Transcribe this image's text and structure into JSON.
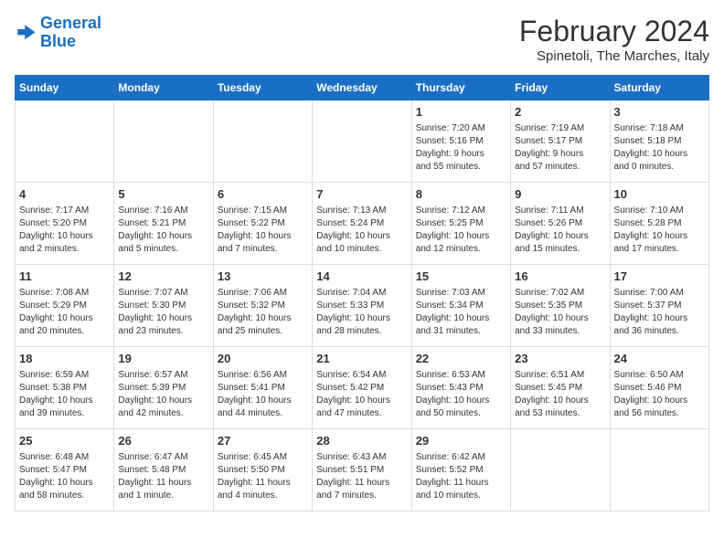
{
  "logo": {
    "line1": "General",
    "line2": "Blue"
  },
  "title": "February 2024",
  "subtitle": "Spinetoli, The Marches, Italy",
  "header": {
    "days": [
      "Sunday",
      "Monday",
      "Tuesday",
      "Wednesday",
      "Thursday",
      "Friday",
      "Saturday"
    ]
  },
  "weeks": [
    [
      {
        "day": "",
        "content": ""
      },
      {
        "day": "",
        "content": ""
      },
      {
        "day": "",
        "content": ""
      },
      {
        "day": "",
        "content": ""
      },
      {
        "day": "1",
        "content": "Sunrise: 7:20 AM\nSunset: 5:16 PM\nDaylight: 9 hours\nand 55 minutes."
      },
      {
        "day": "2",
        "content": "Sunrise: 7:19 AM\nSunset: 5:17 PM\nDaylight: 9 hours\nand 57 minutes."
      },
      {
        "day": "3",
        "content": "Sunrise: 7:18 AM\nSunset: 5:18 PM\nDaylight: 10 hours\nand 0 minutes."
      }
    ],
    [
      {
        "day": "4",
        "content": "Sunrise: 7:17 AM\nSunset: 5:20 PM\nDaylight: 10 hours\nand 2 minutes."
      },
      {
        "day": "5",
        "content": "Sunrise: 7:16 AM\nSunset: 5:21 PM\nDaylight: 10 hours\nand 5 minutes."
      },
      {
        "day": "6",
        "content": "Sunrise: 7:15 AM\nSunset: 5:22 PM\nDaylight: 10 hours\nand 7 minutes."
      },
      {
        "day": "7",
        "content": "Sunrise: 7:13 AM\nSunset: 5:24 PM\nDaylight: 10 hours\nand 10 minutes."
      },
      {
        "day": "8",
        "content": "Sunrise: 7:12 AM\nSunset: 5:25 PM\nDaylight: 10 hours\nand 12 minutes."
      },
      {
        "day": "9",
        "content": "Sunrise: 7:11 AM\nSunset: 5:26 PM\nDaylight: 10 hours\nand 15 minutes."
      },
      {
        "day": "10",
        "content": "Sunrise: 7:10 AM\nSunset: 5:28 PM\nDaylight: 10 hours\nand 17 minutes."
      }
    ],
    [
      {
        "day": "11",
        "content": "Sunrise: 7:08 AM\nSunset: 5:29 PM\nDaylight: 10 hours\nand 20 minutes."
      },
      {
        "day": "12",
        "content": "Sunrise: 7:07 AM\nSunset: 5:30 PM\nDaylight: 10 hours\nand 23 minutes."
      },
      {
        "day": "13",
        "content": "Sunrise: 7:06 AM\nSunset: 5:32 PM\nDaylight: 10 hours\nand 25 minutes."
      },
      {
        "day": "14",
        "content": "Sunrise: 7:04 AM\nSunset: 5:33 PM\nDaylight: 10 hours\nand 28 minutes."
      },
      {
        "day": "15",
        "content": "Sunrise: 7:03 AM\nSunset: 5:34 PM\nDaylight: 10 hours\nand 31 minutes."
      },
      {
        "day": "16",
        "content": "Sunrise: 7:02 AM\nSunset: 5:35 PM\nDaylight: 10 hours\nand 33 minutes."
      },
      {
        "day": "17",
        "content": "Sunrise: 7:00 AM\nSunset: 5:37 PM\nDaylight: 10 hours\nand 36 minutes."
      }
    ],
    [
      {
        "day": "18",
        "content": "Sunrise: 6:59 AM\nSunset: 5:38 PM\nDaylight: 10 hours\nand 39 minutes."
      },
      {
        "day": "19",
        "content": "Sunrise: 6:57 AM\nSunset: 5:39 PM\nDaylight: 10 hours\nand 42 minutes."
      },
      {
        "day": "20",
        "content": "Sunrise: 6:56 AM\nSunset: 5:41 PM\nDaylight: 10 hours\nand 44 minutes."
      },
      {
        "day": "21",
        "content": "Sunrise: 6:54 AM\nSunset: 5:42 PM\nDaylight: 10 hours\nand 47 minutes."
      },
      {
        "day": "22",
        "content": "Sunrise: 6:53 AM\nSunset: 5:43 PM\nDaylight: 10 hours\nand 50 minutes."
      },
      {
        "day": "23",
        "content": "Sunrise: 6:51 AM\nSunset: 5:45 PM\nDaylight: 10 hours\nand 53 minutes."
      },
      {
        "day": "24",
        "content": "Sunrise: 6:50 AM\nSunset: 5:46 PM\nDaylight: 10 hours\nand 56 minutes."
      }
    ],
    [
      {
        "day": "25",
        "content": "Sunrise: 6:48 AM\nSunset: 5:47 PM\nDaylight: 10 hours\nand 58 minutes."
      },
      {
        "day": "26",
        "content": "Sunrise: 6:47 AM\nSunset: 5:48 PM\nDaylight: 11 hours\nand 1 minute."
      },
      {
        "day": "27",
        "content": "Sunrise: 6:45 AM\nSunset: 5:50 PM\nDaylight: 11 hours\nand 4 minutes."
      },
      {
        "day": "28",
        "content": "Sunrise: 6:43 AM\nSunset: 5:51 PM\nDaylight: 11 hours\nand 7 minutes."
      },
      {
        "day": "29",
        "content": "Sunrise: 6:42 AM\nSunset: 5:52 PM\nDaylight: 11 hours\nand 10 minutes."
      },
      {
        "day": "",
        "content": ""
      },
      {
        "day": "",
        "content": ""
      }
    ]
  ]
}
